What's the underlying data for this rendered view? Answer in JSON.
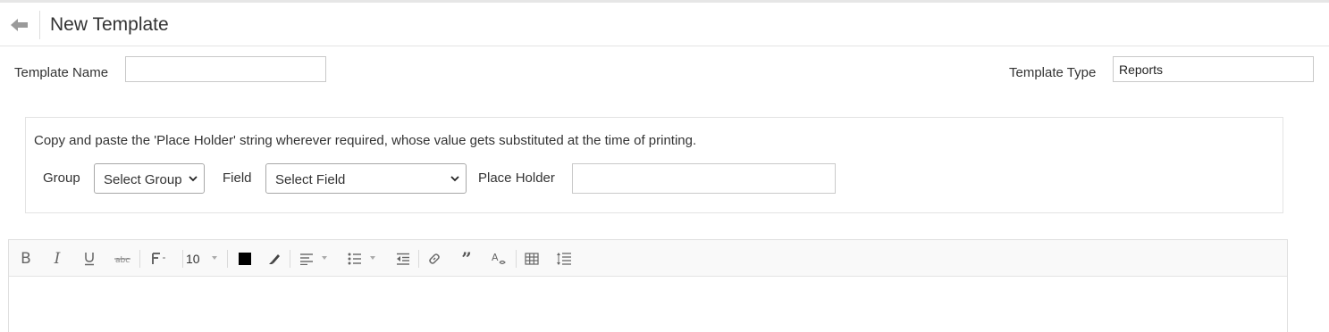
{
  "header": {
    "title": "New Template",
    "back_icon": "arrow-left-icon"
  },
  "form": {
    "template_name_label": "Template Name",
    "template_name_value": "",
    "template_type_label": "Template Type",
    "template_type_value": "Reports"
  },
  "placeholder_panel": {
    "instructions": "Copy and paste the 'Place Holder' string wherever required, whose value gets substituted at the time of printing.",
    "group_label": "Group",
    "group_selected": "Select Group",
    "field_label": "Field",
    "field_selected": "Select Field",
    "place_holder_label": "Place Holder",
    "place_holder_value": ""
  },
  "editor": {
    "font_size": "10",
    "text_color": "#000000",
    "toolbar_icons": [
      "bold-icon",
      "italic-icon",
      "underline-icon",
      "strikethrough-icon",
      "font-family-icon",
      "font-size-select",
      "text-color-icon",
      "highlight-icon",
      "align-icon",
      "bullet-list-icon",
      "outdent-icon",
      "link-icon",
      "quote-icon",
      "clear-format-icon",
      "table-icon",
      "line-height-icon"
    ]
  }
}
